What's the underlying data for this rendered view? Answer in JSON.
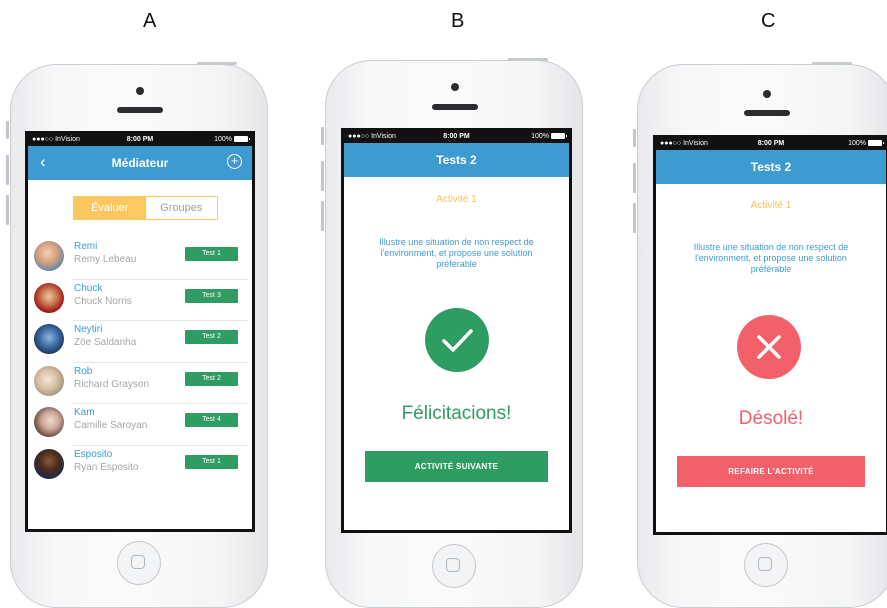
{
  "panel_letters": {
    "a": "A",
    "b": "B",
    "c": "C"
  },
  "status": {
    "carrier": "●●●○○ InVision",
    "time": "8:00 PM",
    "battery": "100%"
  },
  "screen_a": {
    "title": "Médiateur",
    "tabs": {
      "active": "Évaluer",
      "inactive": "Groupes"
    },
    "students": [
      {
        "nick": "Remi",
        "name": "Remy Lebeau",
        "test": "Test 1"
      },
      {
        "nick": "Chuck",
        "name": "Chuck Norris",
        "test": "Test 3"
      },
      {
        "nick": "Neytiri",
        "name": "Zöe Saldanha",
        "test": "Test 2"
      },
      {
        "nick": "Rob",
        "name": "Richard Grayson",
        "test": "Test 2"
      },
      {
        "nick": "Kam",
        "name": "Camille Saroyan",
        "test": "Test 4"
      },
      {
        "nick": "Esposito",
        "name": "Ryan Esposito",
        "test": "Test 1"
      }
    ]
  },
  "screen_b": {
    "title": "Tests 2",
    "activity": "Activité 1",
    "question": "Illustre une situation de non respect de l'environment, et propose une solution préférable",
    "result": "Félicitacions!",
    "button": "ACTIVITÉ SUIVANTE"
  },
  "screen_c": {
    "title": "Tests 2",
    "activity": "Activité 1",
    "question": "Illustre une situation de non respect de l'environment, et propose une solution préférable",
    "result": "Désolé!",
    "button": "REFAIRE L'ACTIVITÉ"
  },
  "colors": {
    "nav_blue": "#3d9bd2",
    "success_green": "#2f9d63",
    "error_red": "#f2616a",
    "accent_yellow": "#fbc75e"
  },
  "icons": {
    "back": "chevron-left-icon",
    "add": "plus-circle-icon",
    "success": "check-icon",
    "failure": "close-icon"
  }
}
